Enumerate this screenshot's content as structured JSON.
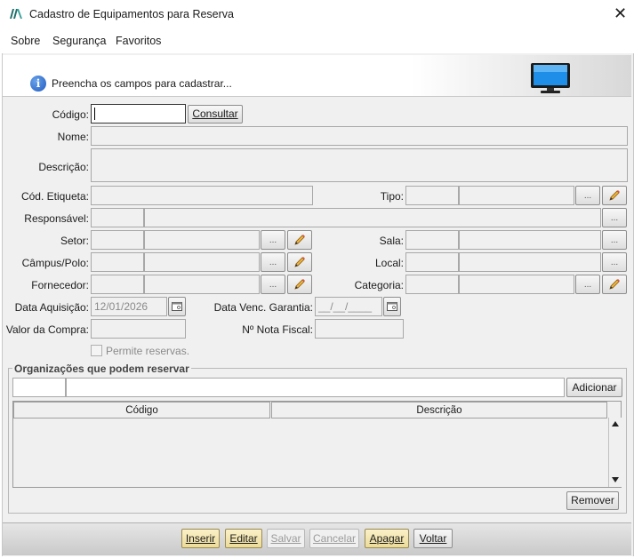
{
  "window": {
    "title": "Cadastro de Equipamentos para Reserva",
    "close": "✕"
  },
  "menu": [
    "Sobre",
    "Segurança",
    "Favoritos"
  ],
  "banner": {
    "text": "Preencha os campos para cadastrar..."
  },
  "form": {
    "codigo_label": "Código:",
    "consultar_label": "Consultar",
    "nome_label": "Nome:",
    "descricao_label": "Descrição:",
    "etiqueta_label": "Cód. Etiqueta:",
    "tipo_label": "Tipo:",
    "responsavel_label": "Responsável:",
    "setor_label": "Setor:",
    "sala_label": "Sala:",
    "campus_label": "Câmpus/Polo:",
    "local_label": "Local:",
    "fornecedor_label": "Fornecedor:",
    "categoria_label": "Categoria:",
    "data_aquisicao_label": "Data Aquisição:",
    "data_aquisicao_value": "12/01/2026",
    "data_garantia_label": "Data Venc. Garantia:",
    "data_garantia_value": "__/__/____",
    "valor_label": "Valor da Compra:",
    "nota_label": "Nº Nota Fiscal:",
    "permite_label": "Permite reservas.",
    "dots": "..."
  },
  "organizations": {
    "title": "Organizações que podem reservar",
    "adicionar_label": "Adicionar",
    "columns": [
      "Código",
      "Descrição"
    ],
    "remover_label": "Remover"
  },
  "actions": {
    "inserir": "Inserir",
    "editar": "Editar",
    "salvar": "Salvar",
    "cancelar": "Cancelar",
    "apagar": "Apagar",
    "voltar": "Voltar"
  },
  "icons": {
    "app": "app-logo-icon",
    "info": "info-icon",
    "monitor": "monitor-icon",
    "edit": "pencil-icon",
    "calendar": "calendar-icon"
  }
}
